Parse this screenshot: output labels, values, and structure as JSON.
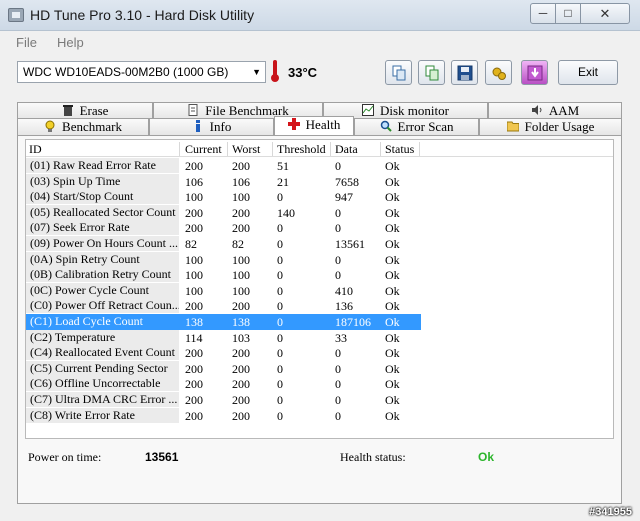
{
  "window": {
    "title": "HD Tune Pro 3.10 - Hard Disk Utility",
    "minimize": "─",
    "maximize": "□",
    "close": "✕"
  },
  "menu": {
    "file": "File",
    "help": "Help"
  },
  "toolbar": {
    "drive": "WDC WD10EADS-00M2B0 (1000 GB)",
    "temperature": "33°C",
    "exit_label": "Exit",
    "icons": [
      "copy-icon",
      "copy-all-icon",
      "save-icon",
      "options-icon",
      "download-icon"
    ]
  },
  "tabs_top": [
    {
      "label": "Erase",
      "icon": "trash-icon"
    },
    {
      "label": "File Benchmark",
      "icon": "file-icon"
    },
    {
      "label": "Disk monitor",
      "icon": "chart-icon"
    },
    {
      "label": "AAM",
      "icon": "speaker-icon"
    }
  ],
  "tabs_bottom": [
    {
      "label": "Benchmark",
      "icon": "bulb-icon"
    },
    {
      "label": "Info",
      "icon": "info-icon"
    },
    {
      "label": "Health",
      "icon": "health-cross-icon",
      "active": true
    },
    {
      "label": "Error Scan",
      "icon": "magnifier-icon"
    },
    {
      "label": "Folder Usage",
      "icon": "folder-icon"
    }
  ],
  "table": {
    "columns": [
      "ID",
      "Current",
      "Worst",
      "Threshold",
      "Data",
      "Status"
    ],
    "rows": [
      [
        "(01) Raw Read Error Rate",
        "200",
        "200",
        "51",
        "0",
        "Ok"
      ],
      [
        "(03) Spin Up Time",
        "106",
        "106",
        "21",
        "7658",
        "Ok"
      ],
      [
        "(04) Start/Stop Count",
        "100",
        "100",
        "0",
        "947",
        "Ok"
      ],
      [
        "(05) Reallocated Sector Count",
        "200",
        "200",
        "140",
        "0",
        "Ok"
      ],
      [
        "(07) Seek Error Rate",
        "200",
        "200",
        "0",
        "0",
        "Ok"
      ],
      [
        "(09) Power On Hours Count ...",
        "82",
        "82",
        "0",
        "13561",
        "Ok"
      ],
      [
        "(0A) Spin Retry Count",
        "100",
        "100",
        "0",
        "0",
        "Ok"
      ],
      [
        "(0B) Calibration Retry Count",
        "100",
        "100",
        "0",
        "0",
        "Ok"
      ],
      [
        "(0C) Power Cycle Count",
        "100",
        "100",
        "0",
        "410",
        "Ok"
      ],
      [
        "(C0) Power Off Retract Coun...",
        "200",
        "200",
        "0",
        "136",
        "Ok"
      ],
      [
        "(C1) Load Cycle Count",
        "138",
        "138",
        "0",
        "187106",
        "Ok"
      ],
      [
        "(C2) Temperature",
        "114",
        "103",
        "0",
        "33",
        "Ok"
      ],
      [
        "(C4) Reallocated Event Count",
        "200",
        "200",
        "0",
        "0",
        "Ok"
      ],
      [
        "(C5) Current Pending Sector",
        "200",
        "200",
        "0",
        "0",
        "Ok"
      ],
      [
        "(C6) Offline Uncorrectable",
        "200",
        "200",
        "0",
        "0",
        "Ok"
      ],
      [
        "(C7) Ultra DMA CRC Error ...",
        "200",
        "200",
        "0",
        "0",
        "Ok"
      ],
      [
        "(C8) Write Error Rate",
        "200",
        "200",
        "0",
        "0",
        "Ok"
      ]
    ],
    "selected_row": 10
  },
  "footer": {
    "power_on_label": "Power on time:",
    "power_on_value": "13561",
    "health_label": "Health status:",
    "health_value": "Ok",
    "health_color": "#2cb52c"
  },
  "watermark": "#341955"
}
